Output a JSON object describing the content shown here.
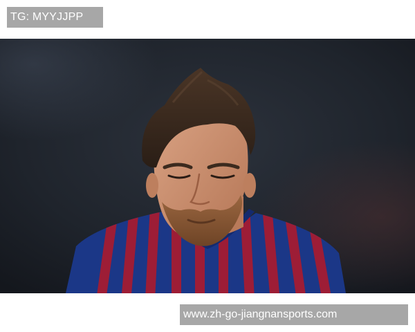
{
  "watermark": {
    "tag_text": "TG: MYYJJPP",
    "url_text": "www.zh-go-jiangnansports.com"
  },
  "photo": {
    "subject": "footballer-portrait",
    "colors": {
      "background": "#1d2128",
      "jersey_blue": "#1f3f9a",
      "jersey_red": "#b3213e",
      "skin": "#c98f6e",
      "hair": "#3a2a1f",
      "beard": "#8c5a34"
    }
  }
}
